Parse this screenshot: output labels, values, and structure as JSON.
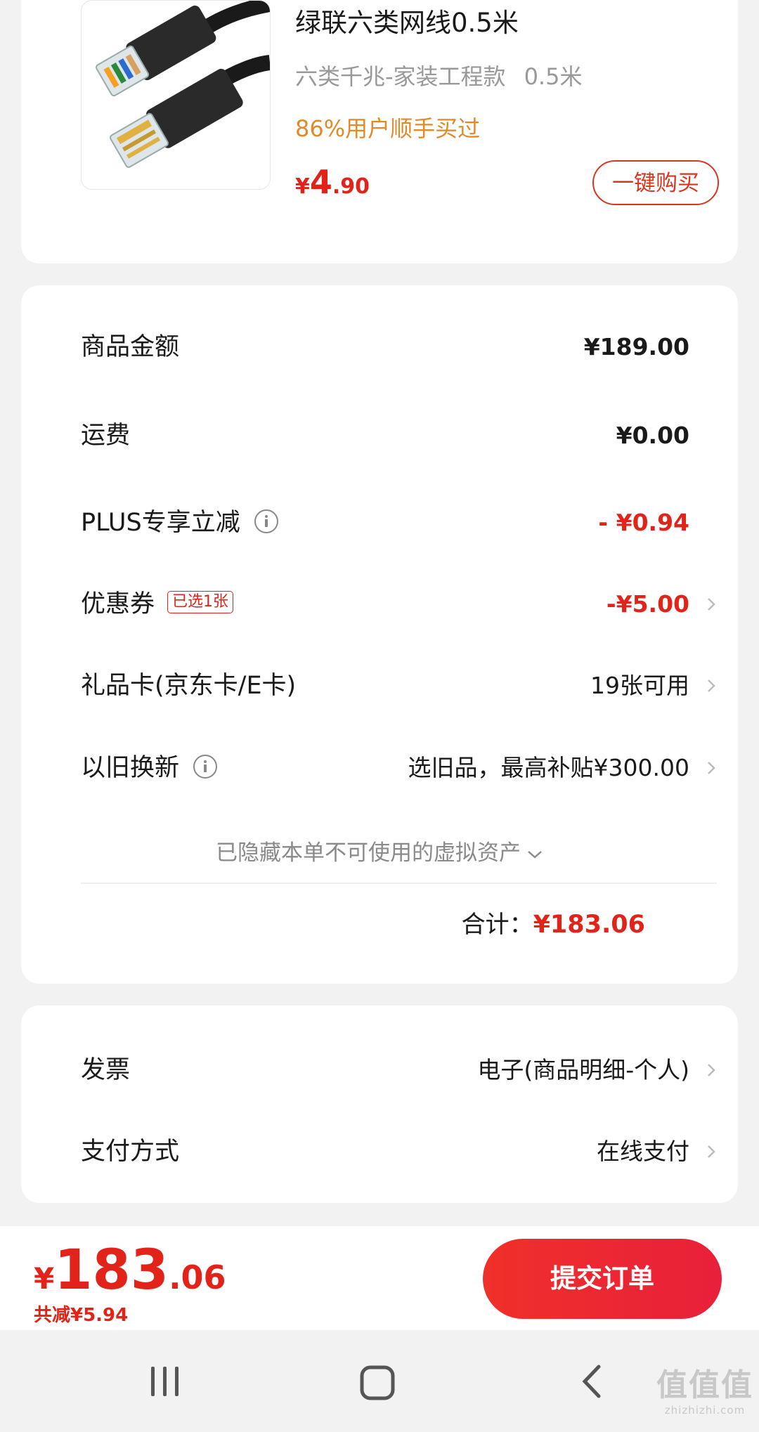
{
  "product": {
    "name": "绿联六类网线0.5米",
    "spec_type": "六类千兆-家装工程款",
    "spec_length": "0.5米",
    "buy_hint": "86%用户顺手买过",
    "price_currency": "¥",
    "price_int": "4",
    "price_dec": ".90",
    "buy_button": "一键购买",
    "image_icon": "ethernet-cable-image"
  },
  "amounts": {
    "goods": {
      "label": "商品金额",
      "value": "¥189.00"
    },
    "shipping": {
      "label": "运费",
      "value": "¥0.00"
    },
    "plus": {
      "label": "PLUS专享立减",
      "value": "- ¥0.94"
    },
    "coupon": {
      "label": "优惠券",
      "badge": "已选1张",
      "value": "-¥5.00"
    },
    "giftcard": {
      "label": "礼品卡(京东卡/E卡)",
      "value": "19张可用"
    },
    "tradein": {
      "label": "以旧换新",
      "value": "选旧品，最高补贴¥300.00"
    },
    "hidden_assets": "已隐藏本单不可使用的虚拟资产",
    "total_label": "合计：",
    "total_value": "¥183.06"
  },
  "invoice": {
    "invoice": {
      "label": "发票",
      "value": "电子(商品明细-个人)"
    },
    "payment": {
      "label": "支付方式",
      "value": "在线支付"
    }
  },
  "bottom": {
    "price_currency": "¥",
    "price_int": "183",
    "price_dec": ".06",
    "saving": "共减¥5.94",
    "submit": "提交订单"
  },
  "watermark": {
    "main": "值值值",
    "sub": "zhizhizhi.com"
  },
  "colors": {
    "accent": "#e2231a",
    "hint": "#e08a2a",
    "background": "#f2f2f2"
  }
}
